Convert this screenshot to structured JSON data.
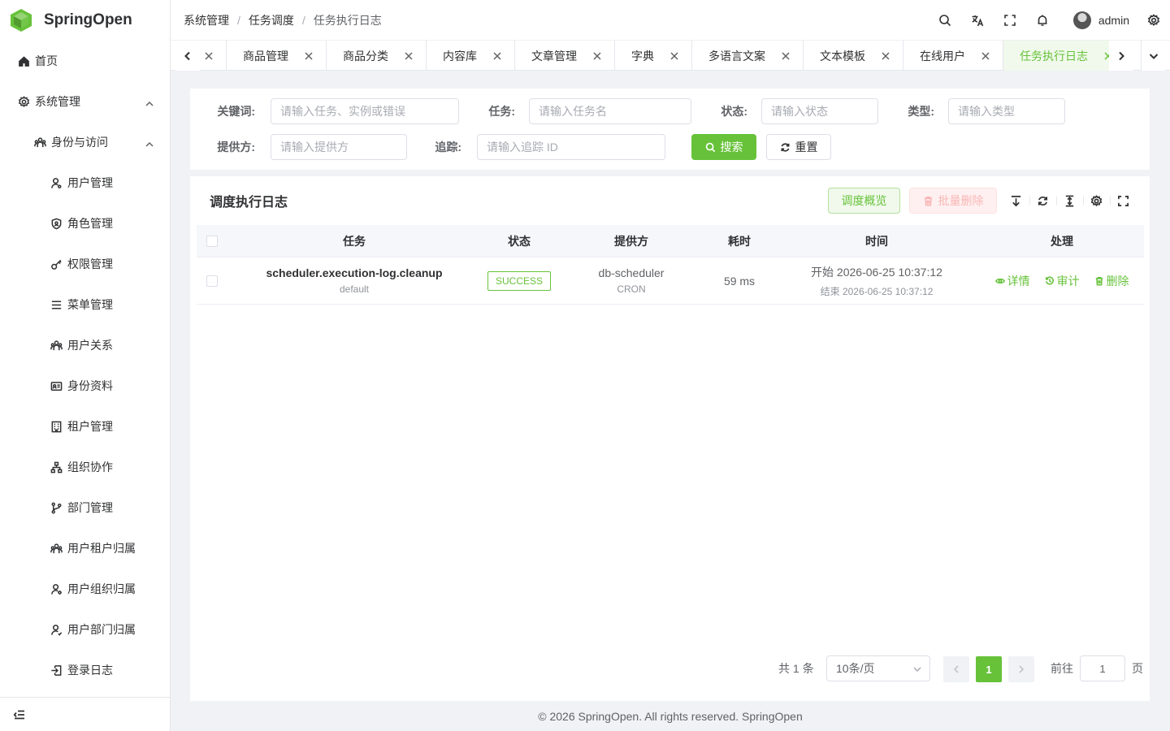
{
  "app": {
    "name": "SpringOpen",
    "brand_color": "#67c23a"
  },
  "sidebar": {
    "items": [
      {
        "label": "首页",
        "icon": "home-icon"
      },
      {
        "label": "系统管理",
        "icon": "gear-icon"
      },
      {
        "label": "身份与访问",
        "icon": "users-icon"
      },
      {
        "label": "用户管理",
        "icon": "user-icon"
      },
      {
        "label": "角色管理",
        "icon": "shield-icon"
      },
      {
        "label": "权限管理",
        "icon": "key-icon"
      },
      {
        "label": "菜单管理",
        "icon": "list-icon"
      },
      {
        "label": "用户关系",
        "icon": "users-icon"
      },
      {
        "label": "身份资料",
        "icon": "id-card-icon"
      },
      {
        "label": "租户管理",
        "icon": "building-icon"
      },
      {
        "label": "组织协作",
        "icon": "org-icon"
      },
      {
        "label": "部门管理",
        "icon": "branch-icon"
      },
      {
        "label": "用户租户归属",
        "icon": "users-icon"
      },
      {
        "label": "用户组织归属",
        "icon": "user-gear-icon"
      },
      {
        "label": "用户部门归属",
        "icon": "user-check-icon"
      },
      {
        "label": "登录日志",
        "icon": "login-icon"
      }
    ]
  },
  "header": {
    "breadcrumb": [
      "系统管理",
      "任务调度",
      "任务执行日志"
    ],
    "username": "admin"
  },
  "tabs": [
    {
      "label": ""
    },
    {
      "label": "商品管理"
    },
    {
      "label": "商品分类"
    },
    {
      "label": "内容库"
    },
    {
      "label": "文章管理"
    },
    {
      "label": "字典"
    },
    {
      "label": "多语言文案"
    },
    {
      "label": "文本模板"
    },
    {
      "label": "在线用户"
    },
    {
      "label": "任务执行日志"
    }
  ],
  "search": {
    "keyword_label": "关键词:",
    "keyword_placeholder": "请输入任务、实例或错误",
    "task_label": "任务:",
    "task_placeholder": "请输入任务名",
    "status_label": "状态:",
    "status_placeholder": "请输入状态",
    "type_label": "类型:",
    "type_placeholder": "请输入类型",
    "provider_label": "提供方:",
    "provider_placeholder": "请输入提供方",
    "trace_label": "追踪:",
    "trace_placeholder": "请输入追踪 ID",
    "search_button": "搜索",
    "reset_button": "重置"
  },
  "table_card": {
    "title": "调度执行日志",
    "overview_button": "调度概览",
    "batch_delete_button": "批量删除",
    "columns": [
      "任务",
      "状态",
      "提供方",
      "耗时",
      "时间",
      "处理"
    ],
    "rows": [
      {
        "task": "scheduler.execution-log.cleanup",
        "group": "default",
        "status": "SUCCESS",
        "provider": "db-scheduler",
        "provider_type": "CRON",
        "duration": "59 ms",
        "start": "开始 2026-06-25 10:37:12",
        "end": "结束 2026-06-25 10:37:12",
        "actions": [
          "详情",
          "审计",
          "删除"
        ]
      }
    ]
  },
  "pagination": {
    "total": "共 1 条",
    "page_size": "10条/页",
    "current_page": "1",
    "goto_label": "前往",
    "goto_value": "1",
    "page_suffix": "页"
  },
  "footer": {
    "text": "© 2026 SpringOpen. All rights reserved. SpringOpen"
  }
}
